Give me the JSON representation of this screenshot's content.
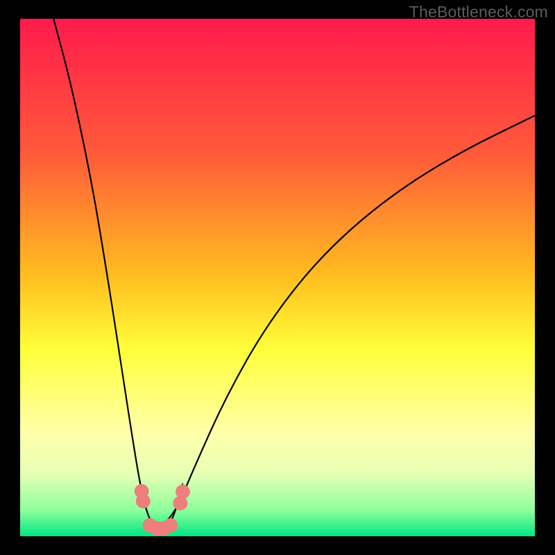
{
  "watermark": "TheBottleneck.com",
  "colors": {
    "gradient_css": "linear-gradient(to bottom, #ff1b4c 0%, #ff5a3a 26%, #ffbf1f 50%, #ffff3a 64%, #ffffaa 80%, #e6ffb4 88%, #8cff9c 95%, #00e682 100%)",
    "curve_stroke": "#000000",
    "marker_fill": "#ed7e7b"
  },
  "chart_data": {
    "type": "line",
    "title": "",
    "xlabel": "",
    "ylabel": "",
    "x_range": [
      0,
      100
    ],
    "y_range": [
      0,
      100
    ],
    "note": "No axis ticks/labels present in image; values are relative percentages of plot area (0=left/bottom, 100=right/top). Two V-shaped bottleneck curves share a minimum near x≈27.",
    "series": [
      {
        "name": "left-curve",
        "points": [
          {
            "x": 6.5,
            "y": 100
          },
          {
            "x": 10,
            "y": 87
          },
          {
            "x": 14,
            "y": 68
          },
          {
            "x": 17,
            "y": 50
          },
          {
            "x": 19.5,
            "y": 34
          },
          {
            "x": 21.5,
            "y": 21
          },
          {
            "x": 23.3,
            "y": 10
          },
          {
            "x": 24.6,
            "y": 4.6
          },
          {
            "x": 26.2,
            "y": 1.2
          },
          {
            "x": 28.4,
            "y": 1.2
          },
          {
            "x": 30,
            "y": 4.2
          },
          {
            "x": 31.6,
            "y": 10.2
          }
        ]
      },
      {
        "name": "right-curve",
        "points": [
          {
            "x": 26.2,
            "y": 1.2
          },
          {
            "x": 30,
            "y": 4.2
          },
          {
            "x": 33.6,
            "y": 12.8
          },
          {
            "x": 40,
            "y": 27
          },
          {
            "x": 48,
            "y": 41
          },
          {
            "x": 58,
            "y": 53.7
          },
          {
            "x": 70,
            "y": 64.4
          },
          {
            "x": 84,
            "y": 73.5
          },
          {
            "x": 100,
            "y": 81.3
          }
        ]
      }
    ],
    "markers": [
      {
        "x": 23.6,
        "y": 8.7,
        "r": 1.4
      },
      {
        "x": 23.9,
        "y": 6.8,
        "r": 1.4
      },
      {
        "x": 25.2,
        "y": 2.1,
        "r": 1.4
      },
      {
        "x": 26.6,
        "y": 1.5,
        "r": 1.4
      },
      {
        "x": 27.9,
        "y": 1.5,
        "r": 1.4
      },
      {
        "x": 29.2,
        "y": 2.1,
        "r": 1.4
      },
      {
        "x": 31.1,
        "y": 6.4,
        "r": 1.4
      },
      {
        "x": 31.6,
        "y": 8.6,
        "r": 1.4
      }
    ]
  }
}
